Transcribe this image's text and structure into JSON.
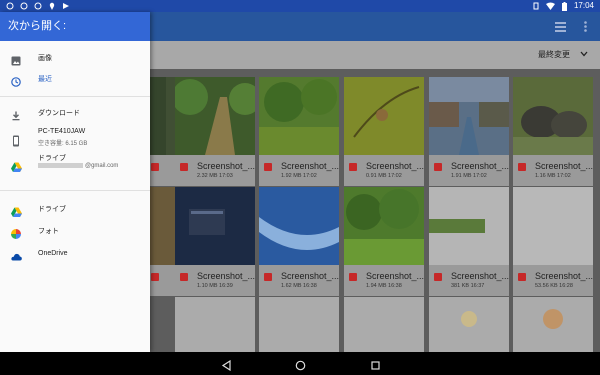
{
  "status_bar": {
    "time": "17:04",
    "left_icons": [
      "sync-icon",
      "sync-icon",
      "sync-icon",
      "location-icon",
      "play-icon"
    ],
    "right_icons": [
      "vibrate-icon",
      "wifi-icon",
      "battery-icon"
    ]
  },
  "drawer": {
    "title": "次から開く:",
    "items": [
      {
        "label": "画像",
        "icon": "image-icon"
      },
      {
        "label": "最近",
        "icon": "clock-icon",
        "active": true
      },
      {
        "label": "ダウンロード",
        "icon": "download-icon"
      },
      {
        "label": "PC-TE410JAW",
        "sub": "空き容量: 6.15 GB",
        "icon": "phone-icon"
      },
      {
        "label": "ドライブ",
        "sub": "@gmail.com",
        "icon": "drive-icon"
      },
      {
        "label": "ドライブ",
        "icon": "drive-icon"
      },
      {
        "label": "フォト",
        "icon": "photos-icon"
      },
      {
        "label": "OneDrive",
        "icon": "onedrive-icon"
      }
    ]
  },
  "toolbar": {
    "sort_label": "最終変更"
  },
  "grid": {
    "row1": [
      {
        "name": "Screenshot_...",
        "meta": "2.32 MB 17:03"
      },
      {
        "name": "Screenshot_...",
        "meta": "1.92 MB 17:02"
      },
      {
        "name": "Screenshot_...",
        "meta": "0.91 MB 17:02"
      },
      {
        "name": "Screenshot_...",
        "meta": "1.91 MB 17:02"
      },
      {
        "name": "Screenshot_...",
        "meta": "1.16 MB 17:02"
      }
    ],
    "row2": [
      {
        "name": "Screenshot_...",
        "meta": "1.10 MB 16:39"
      },
      {
        "name": "Screenshot_...",
        "meta": "1.62 MB 16:38"
      },
      {
        "name": "Screenshot_...",
        "meta": "1.94 MB 16:38"
      },
      {
        "name": "Screenshot_...",
        "meta": "381 KB 16:37"
      },
      {
        "name": "Screenshot_...",
        "meta": "53.56 KB 16:28"
      }
    ]
  },
  "colors": {
    "accent": "#3367d6",
    "status_bar": "#1f49a8",
    "file_icon": "#c62828"
  }
}
